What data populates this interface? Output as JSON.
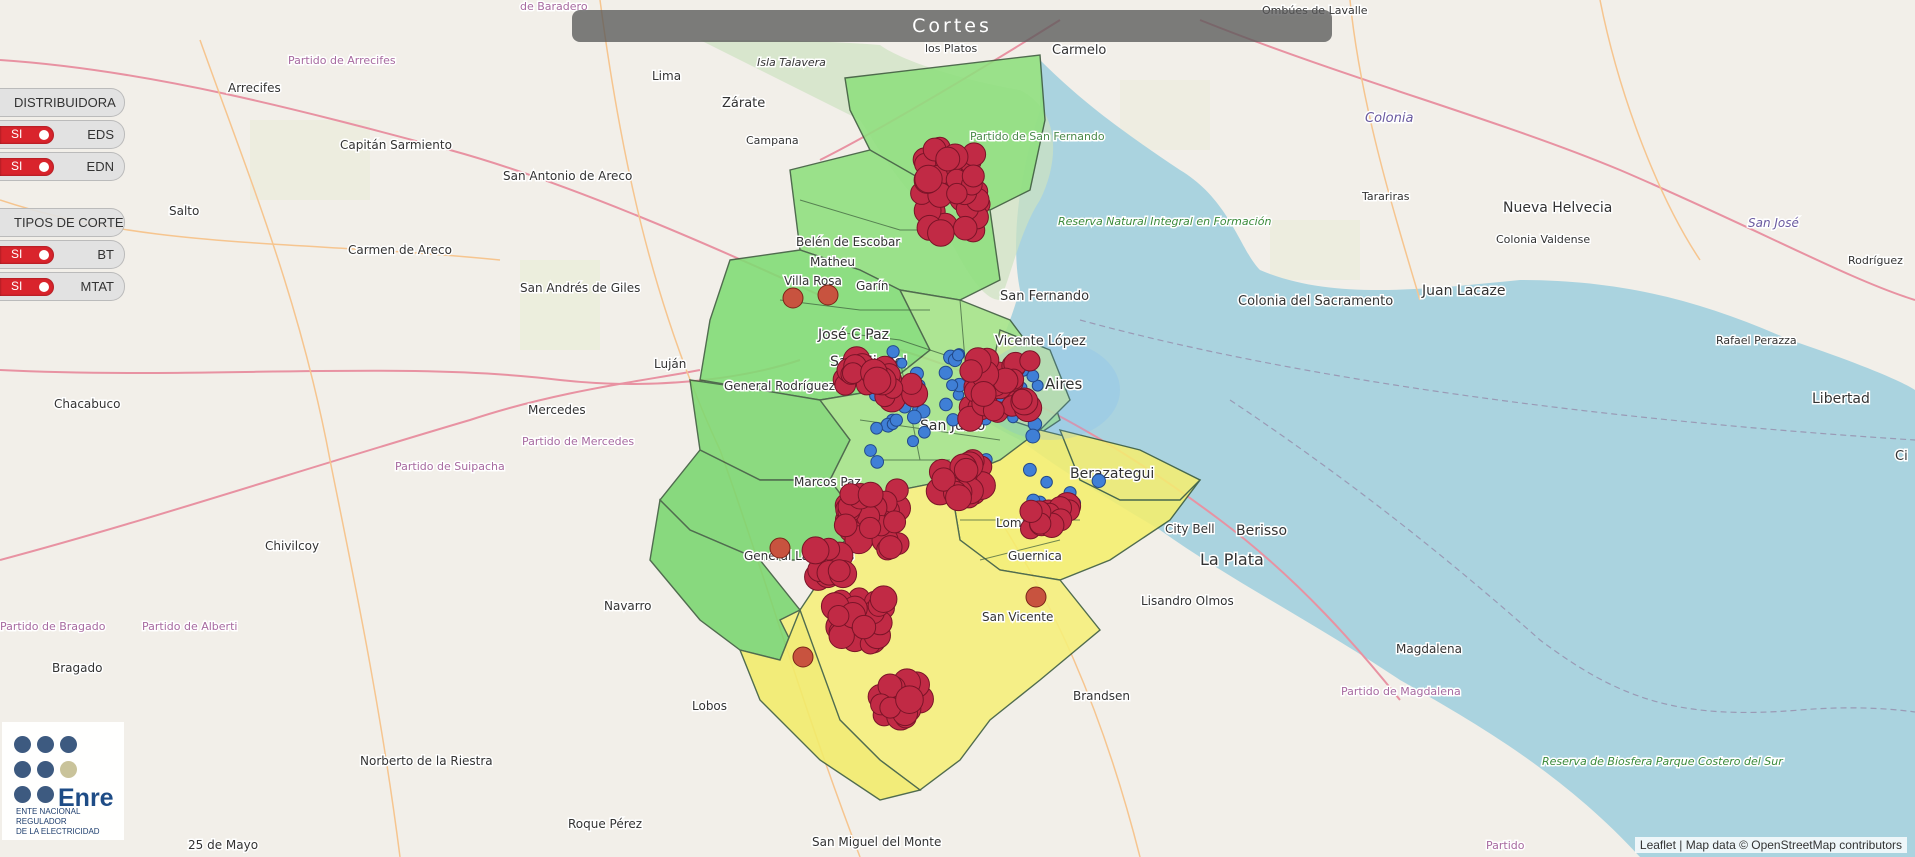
{
  "title": "Cortes",
  "panel": {
    "distribuidora_header": "DISTRIBUIDORA",
    "distribuidoras": [
      {
        "toggle": "SI",
        "name": "EDS"
      },
      {
        "toggle": "SI",
        "name": "EDN"
      }
    ],
    "tipos_header": "TIPOS DE CORTE",
    "tipos": [
      {
        "toggle": "SI",
        "name": "BT"
      },
      {
        "toggle": "SI",
        "name": "MTAT"
      }
    ]
  },
  "logo": {
    "word": "Enre",
    "line1": "ENTE NACIONAL REGULADOR",
    "line2": "DE LA ELECTRICIDAD"
  },
  "attribution": {
    "leaflet": "Leaflet",
    "sep": " | Map data © ",
    "osm": "OpenStreetMap contributors"
  },
  "map_labels": {
    "arrecifes": "Arrecifes",
    "partido_arrecifes": "Partido de Arrecifes",
    "lima": "Lima",
    "zarate": "Zárate",
    "isla_talavera": "Isla Talavera",
    "campana": "Campana",
    "capitan_sarmiento": "Capitán Sarmiento",
    "san_antonio_areco": "San Antonio de Areco",
    "salto": "Salto",
    "carmen_areco": "Carmen de Areco",
    "san_andres_giles": "San Andrés de Giles",
    "lujan": "Luján",
    "chacabuco": "Chacabuco",
    "mercedes": "Mercedes",
    "partido_mercedes": "Partido de Mercedes",
    "partido_suipacha": "Partido de Suipacha",
    "chivilcoy": "Chivilcoy",
    "partido_bragado": "Partido de Bragado",
    "partido_alberti": "Partido de Alberti",
    "bragado": "Bragado",
    "navarro": "Navarro",
    "lobos": "Lobos",
    "norberto_riestra": "Norberto de la Riestra",
    "roque_perez": "Roque Pérez",
    "san_miguel_monte": "San Miguel del Monte",
    "veinticinco_mayo": "25 de Mayo",
    "carmelo": "Carmelo",
    "ombues": "Ombúes de Lavalle",
    "colonia": "Colonia",
    "tarariras": "Tarariras",
    "nueva_helvecia": "Nueva Helvecia",
    "colonia_valdense": "Colonia Valdense",
    "san_jose": "San José",
    "rodriguez": "Rodríguez",
    "colonia_sacramento": "Colonia del Sacramento",
    "juan_lacaze": "Juan Lacaze",
    "rafael_perazza": "Rafael Perazza",
    "libertad": "Libertad",
    "reserva_natural": "Reserva Natural Integral en Formación",
    "city_bell": "City Bell",
    "berisso": "Berisso",
    "la_plata": "La Plata",
    "lisandro_olmos": "Lisandro Olmos",
    "magdalena": "Magdalena",
    "partido_magdalena": "Partido de Magdalena",
    "brandsen": "Brandsen",
    "reserva_biosfera": "Reserva de Biosfera Parque Costero del Sur",
    "partido_bottom": "Partido",
    "buenos_aires": "Aires",
    "san_fernando": "San Fernando",
    "escobar": "Belén de Escobar",
    "matheu": "Matheu",
    "villa_rosa": "Villa Rosa",
    "garin": "Garín",
    "jose_c_paz": "José C Paz",
    "san_miguel": "San Miguel",
    "general_rodriguez": "General Rodríguez",
    "marcos_paz": "Marcos Paz",
    "general_las_heras": "General Las Heras",
    "san_justo": "San Justo",
    "berazategui": "Berazategui",
    "san_vicente": "San Vicente",
    "vicente_lopez": "Vicente López",
    "lomas": "Lomas",
    "guernica": "Guernica",
    "partido_san_fernando": "Partido de San Fernando",
    "de_baradero": "de Baradero",
    "los_platos": "los Platos",
    "ciudad_label": "Ci"
  }
}
